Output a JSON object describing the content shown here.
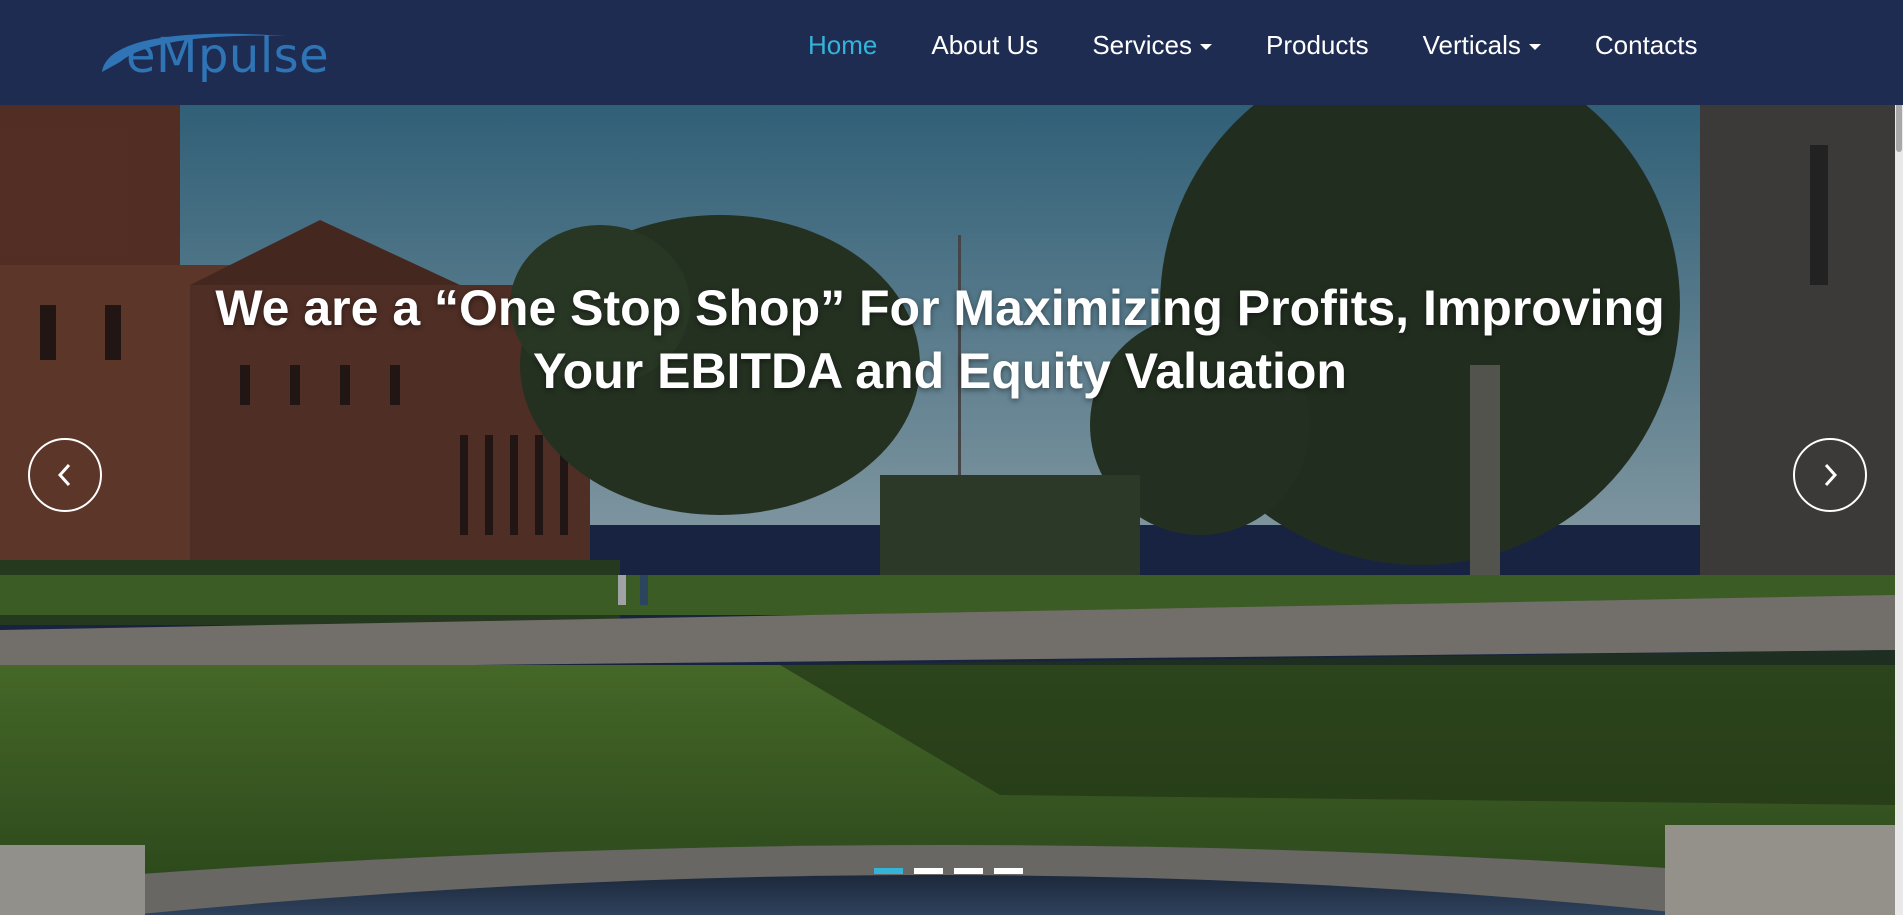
{
  "brand": {
    "logo_text": "eMpulse"
  },
  "nav": {
    "items": [
      {
        "label": "Home",
        "active": true
      },
      {
        "label": "About Us"
      },
      {
        "label": "Services",
        "dropdown": true
      },
      {
        "label": "Products"
      },
      {
        "label": "Verticals",
        "dropdown": true
      },
      {
        "label": "Contacts"
      }
    ]
  },
  "hero": {
    "headline_line1": "We are a “One Stop Shop” For Maximizing Profits, Improving",
    "headline_line2": "Your EBITDA and Equity Valuation",
    "slides_count": 4,
    "active_slide": 1,
    "prev_icon": "chevron-left-icon",
    "next_icon": "chevron-right-icon"
  },
  "colors": {
    "header_bg": "#1e2c52",
    "accent": "#34b4d8",
    "logo": "#2f74b5"
  }
}
